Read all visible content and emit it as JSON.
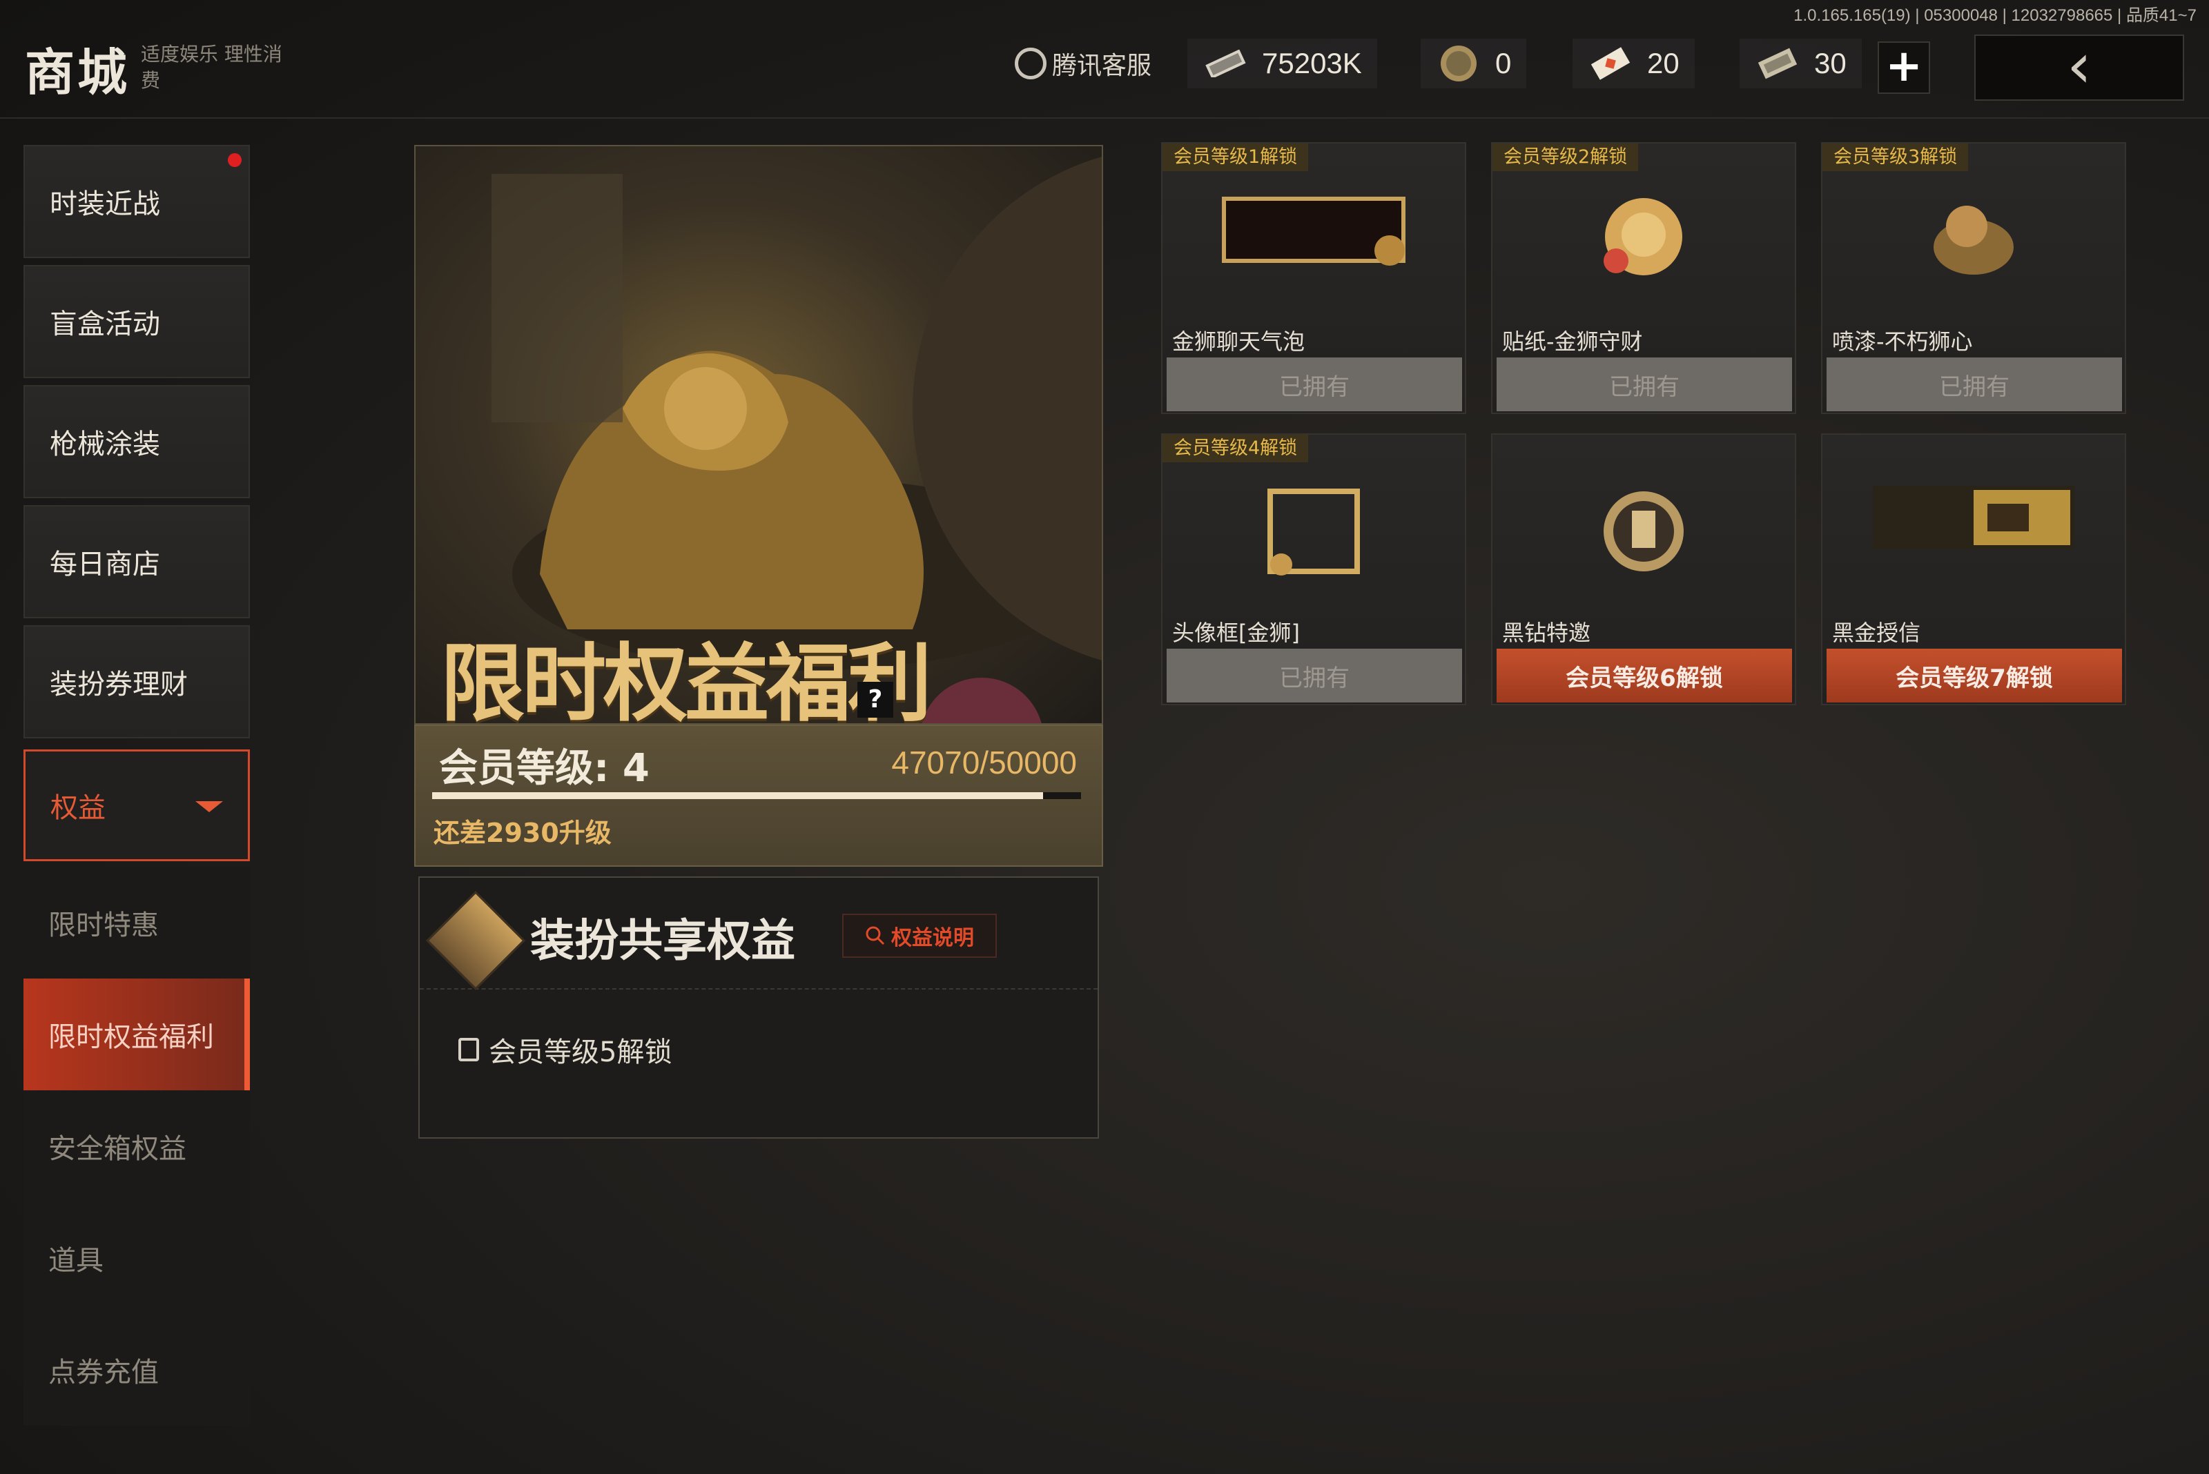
{
  "build_info": "1.0.165.165(19) | 05300048 | 12032798665 | 品质41~7",
  "header": {
    "title": "商城",
    "slogan": "适度娱乐 理性消费",
    "customer_service": "腾讯客服",
    "currencies": [
      {
        "icon": "ticket-icon",
        "value": "75203K"
      },
      {
        "icon": "coin-icon",
        "value": "0"
      },
      {
        "icon": "diamond-ticket-icon",
        "value": "20"
      },
      {
        "icon": "voucher-icon",
        "value": "30"
      }
    ],
    "plus_label": "+",
    "back_label": "‹"
  },
  "sidebar": {
    "items": [
      {
        "label": "时装近战",
        "badge": true
      },
      {
        "label": "盲盒活动"
      },
      {
        "label": "枪械涂装"
      },
      {
        "label": "每日商店"
      },
      {
        "label": "装扮券理财"
      },
      {
        "label": "权益",
        "active": true
      }
    ],
    "subitems": [
      {
        "label": "限时特惠"
      },
      {
        "label": "限时权益福利",
        "active": true
      },
      {
        "label": "安全箱权益"
      },
      {
        "label": "道具"
      },
      {
        "label": "点券充值"
      }
    ]
  },
  "hero": {
    "title": "限时权益福利",
    "help": "?"
  },
  "member": {
    "level_label": "会员等级: 4",
    "points": "47070/50000",
    "progress": 0.9414,
    "need_label": "还差2930升级"
  },
  "share": {
    "title": "装扮共享权益",
    "explain_label": "权益说明",
    "unlock_label": "会员等级5解锁"
  },
  "rewards": [
    {
      "tag": "会员等级1解锁",
      "name": "金狮聊天气泡",
      "button": "已拥有",
      "state": "owned"
    },
    {
      "tag": "会员等级2解锁",
      "name": "贴纸-金狮守财",
      "button": "已拥有",
      "state": "owned"
    },
    {
      "tag": "会员等级3解锁",
      "name": "喷漆-不朽狮心",
      "button": "已拥有",
      "state": "owned"
    },
    {
      "tag": "会员等级4解锁",
      "name": "头像框[金狮]",
      "button": "已拥有",
      "state": "owned"
    },
    {
      "tag": "",
      "name": "黑钻特邀",
      "button": "会员等级6解锁",
      "state": "locked"
    },
    {
      "tag": "",
      "name": "黑金授信",
      "button": "会员等级7解锁",
      "state": "locked"
    }
  ],
  "colors": {
    "accent": "#d2492b",
    "gold": "#e8b867",
    "tag_gold": "#e7b84a"
  }
}
